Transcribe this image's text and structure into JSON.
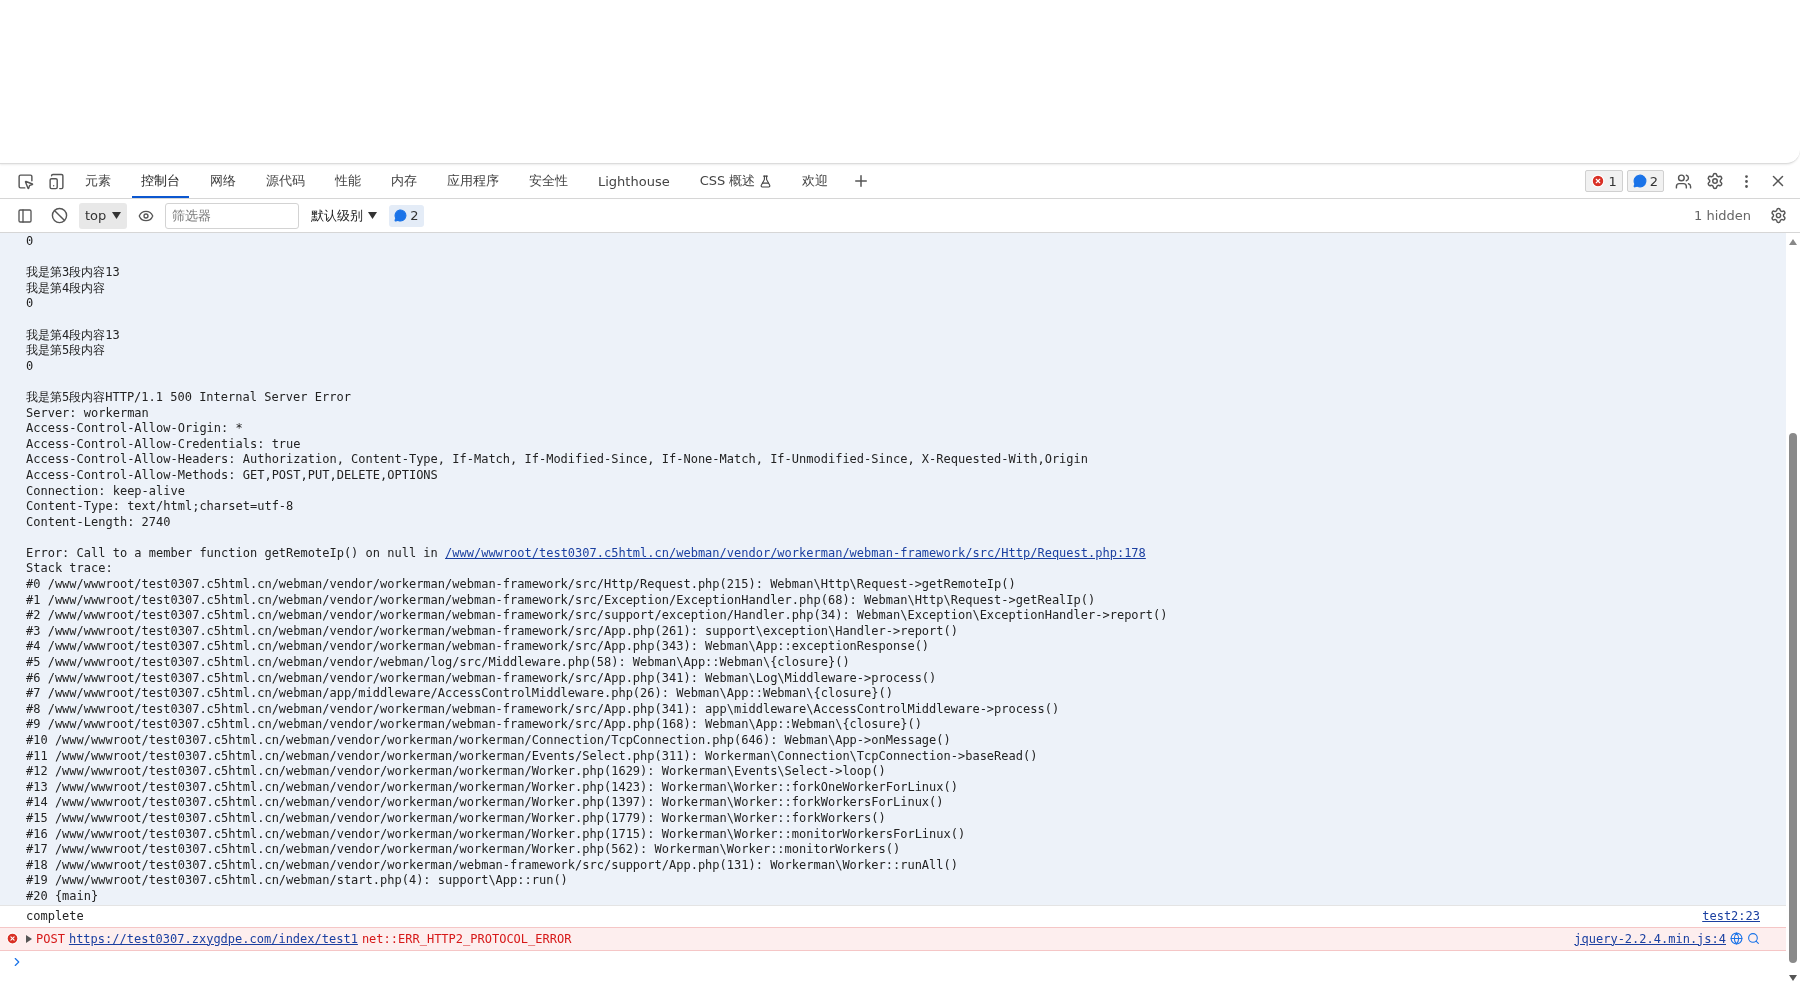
{
  "devtools_tabs": [
    {
      "label": "元素",
      "selected": false
    },
    {
      "label": "控制台",
      "selected": true
    },
    {
      "label": "网络",
      "selected": false
    },
    {
      "label": "源代码",
      "selected": false
    },
    {
      "label": "性能",
      "selected": false
    },
    {
      "label": "内存",
      "selected": false
    },
    {
      "label": "应用程序",
      "selected": false
    },
    {
      "label": "安全性",
      "selected": false
    },
    {
      "label": "Lighthouse",
      "selected": false
    },
    {
      "label": "CSS 概述",
      "selected": false,
      "experimental": true
    },
    {
      "label": "欢迎",
      "selected": false
    }
  ],
  "counts": {
    "errors": "1",
    "messages": "2"
  },
  "console_toolbar": {
    "context": "top",
    "filter_placeholder": "筛选器",
    "levels": "默认级别",
    "message_count": "2",
    "hidden": "1 hidden"
  },
  "log_paragraphs": [
    [
      {
        "text": "0"
      }
    ],
    [
      {
        "text": "我是第3段内容13"
      },
      {
        "text": "我是第4段内容"
      },
      {
        "text": "0"
      }
    ],
    [
      {
        "text": "我是第4段内容13"
      },
      {
        "text": "我是第5段内容"
      },
      {
        "text": "0"
      }
    ],
    [
      {
        "text": "我是第5段内容HTTP/1.1 500 Internal Server Error"
      },
      {
        "text": "Server: workerman"
      },
      {
        "text": "Access-Control-Allow-Origin: *"
      },
      {
        "text": "Access-Control-Allow-Credentials: true"
      },
      {
        "text": "Access-Control-Allow-Headers: Authorization, Content-Type, If-Match, If-Modified-Since, If-None-Match, If-Unmodified-Since, X-Requested-With,Origin"
      },
      {
        "text": "Access-Control-Allow-Methods: GET,POST,PUT,DELETE,OPTIONS"
      },
      {
        "text": "Connection: keep-alive"
      },
      {
        "text": "Content-Type: text/html;charset=utf-8"
      },
      {
        "text": "Content-Length: 2740"
      }
    ],
    [
      {
        "text": "Error: Call to a member function getRemoteIp() on null in ",
        "link": "/www/wwwroot/test0307.c5html.cn/webman/vendor/workerman/webman-framework/src/Http/Request.php:178"
      },
      {
        "text": "Stack trace:"
      },
      {
        "text": "#0 /www/wwwroot/test0307.c5html.cn/webman/vendor/workerman/webman-framework/src/Http/Request.php(215): Webman\\Http\\Request->getRemoteIp()"
      },
      {
        "text": "#1 /www/wwwroot/test0307.c5html.cn/webman/vendor/workerman/webman-framework/src/Exception/ExceptionHandler.php(68): Webman\\Http\\Request->getRealIp()"
      },
      {
        "text": "#2 /www/wwwroot/test0307.c5html.cn/webman/vendor/workerman/webman-framework/src/support/exception/Handler.php(34): Webman\\Exception\\ExceptionHandler->report()"
      },
      {
        "text": "#3 /www/wwwroot/test0307.c5html.cn/webman/vendor/workerman/webman-framework/src/App.php(261): support\\exception\\Handler->report()"
      },
      {
        "text": "#4 /www/wwwroot/test0307.c5html.cn/webman/vendor/workerman/webman-framework/src/App.php(343): Webman\\App::exceptionResponse()"
      },
      {
        "text": "#5 /www/wwwroot/test0307.c5html.cn/webman/vendor/webman/log/src/Middleware.php(58): Webman\\App::Webman\\{closure}()"
      },
      {
        "text": "#6 /www/wwwroot/test0307.c5html.cn/webman/vendor/workerman/webman-framework/src/App.php(341): Webman\\Log\\Middleware->process()"
      },
      {
        "text": "#7 /www/wwwroot/test0307.c5html.cn/webman/app/middleware/AccessControlMiddleware.php(26): Webman\\App::Webman\\{closure}()"
      },
      {
        "text": "#8 /www/wwwroot/test0307.c5html.cn/webman/vendor/workerman/webman-framework/src/App.php(341): app\\middleware\\AccessControlMiddleware->process()"
      },
      {
        "text": "#9 /www/wwwroot/test0307.c5html.cn/webman/vendor/workerman/webman-framework/src/App.php(168): Webman\\App::Webman\\{closure}()"
      },
      {
        "text": "#10 /www/wwwroot/test0307.c5html.cn/webman/vendor/workerman/workerman/Connection/TcpConnection.php(646): Webman\\App->onMessage()"
      },
      {
        "text": "#11 /www/wwwroot/test0307.c5html.cn/webman/vendor/workerman/workerman/Events/Select.php(311): Workerman\\Connection\\TcpConnection->baseRead()"
      },
      {
        "text": "#12 /www/wwwroot/test0307.c5html.cn/webman/vendor/workerman/workerman/Worker.php(1629): Workerman\\Events\\Select->loop()"
      },
      {
        "text": "#13 /www/wwwroot/test0307.c5html.cn/webman/vendor/workerman/workerman/Worker.php(1423): Workerman\\Worker::forkOneWorkerForLinux()"
      },
      {
        "text": "#14 /www/wwwroot/test0307.c5html.cn/webman/vendor/workerman/workerman/Worker.php(1397): Workerman\\Worker::forkWorkersForLinux()"
      },
      {
        "text": "#15 /www/wwwroot/test0307.c5html.cn/webman/vendor/workerman/workerman/Worker.php(1779): Workerman\\Worker::forkWorkers()"
      },
      {
        "text": "#16 /www/wwwroot/test0307.c5html.cn/webman/vendor/workerman/workerman/Worker.php(1715): Workerman\\Worker::monitorWorkersForLinux()"
      },
      {
        "text": "#17 /www/wwwroot/test0307.c5html.cn/webman/vendor/workerman/workerman/Worker.php(562): Workerman\\Worker::monitorWorkers()"
      },
      {
        "text": "#18 /www/wwwroot/test0307.c5html.cn/webman/vendor/workerman/webman-framework/src/support/App.php(131): Workerman\\Worker::runAll()"
      },
      {
        "text": "#19 /www/wwwroot/test0307.c5html.cn/webman/start.php(4): support\\App::run()"
      },
      {
        "text": "#20 {main}"
      }
    ]
  ],
  "messages": [
    {
      "kind": "log",
      "text": "complete",
      "source": "test2:23"
    },
    {
      "kind": "error",
      "method": "POST",
      "url": "https://test0307.zxygdpe.com/index/test1",
      "text": "net::ERR_HTTP2_PROTOCOL_ERROR",
      "source": "jquery-2.2.4.min.js:4"
    }
  ]
}
